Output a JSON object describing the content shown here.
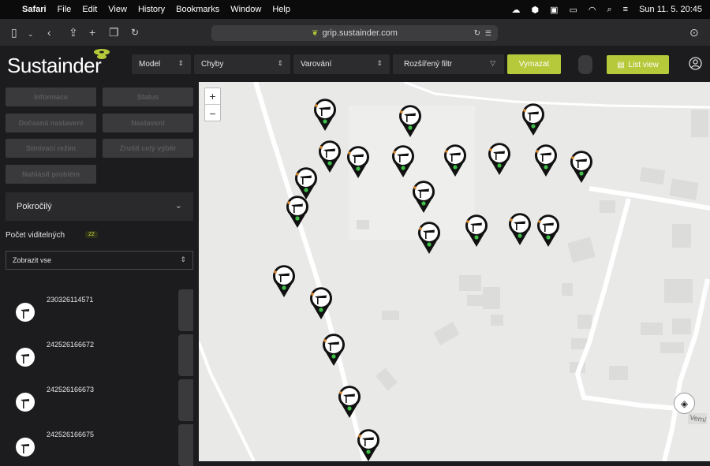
{
  "menubar": {
    "apple": "",
    "app": "Safari",
    "items": [
      "File",
      "Edit",
      "View",
      "History",
      "Bookmarks",
      "Window",
      "Help"
    ],
    "datetime": "Sun 11. 5.  20:45"
  },
  "browser": {
    "url": "grip.sustainder.com"
  },
  "header": {
    "logo": "Sustainder",
    "filters": [
      {
        "label": "Model"
      },
      {
        "label": "Chyby"
      },
      {
        "label": "Varování"
      },
      {
        "label": "Rozšířený filtr"
      }
    ],
    "clear_label": "Vymazat",
    "list_view_label": "List view",
    "accent": "#b5c93a"
  },
  "sidebar": {
    "buttons": [
      {
        "label": "Informace"
      },
      {
        "label": "Status"
      },
      {
        "label": "Dočasná nastavení"
      },
      {
        "label": "Nastavení"
      },
      {
        "label": "Stmívací režim"
      },
      {
        "label": "Zrušit celý výběr"
      },
      {
        "label": "Nahlásit problém"
      }
    ],
    "advanced_label": "Pokročilý",
    "visible_label": "Počet viditelných",
    "visible_count": "22",
    "show_select": "Zobrazit vse",
    "items": [
      {
        "id": "230326114571"
      },
      {
        "id": "242526166672"
      },
      {
        "id": "242526166673"
      },
      {
        "id": "242526166675"
      }
    ]
  },
  "map": {
    "zoom_in": "+",
    "zoom_out": "−",
    "pin_count": 22,
    "street_label": "Verní"
  }
}
